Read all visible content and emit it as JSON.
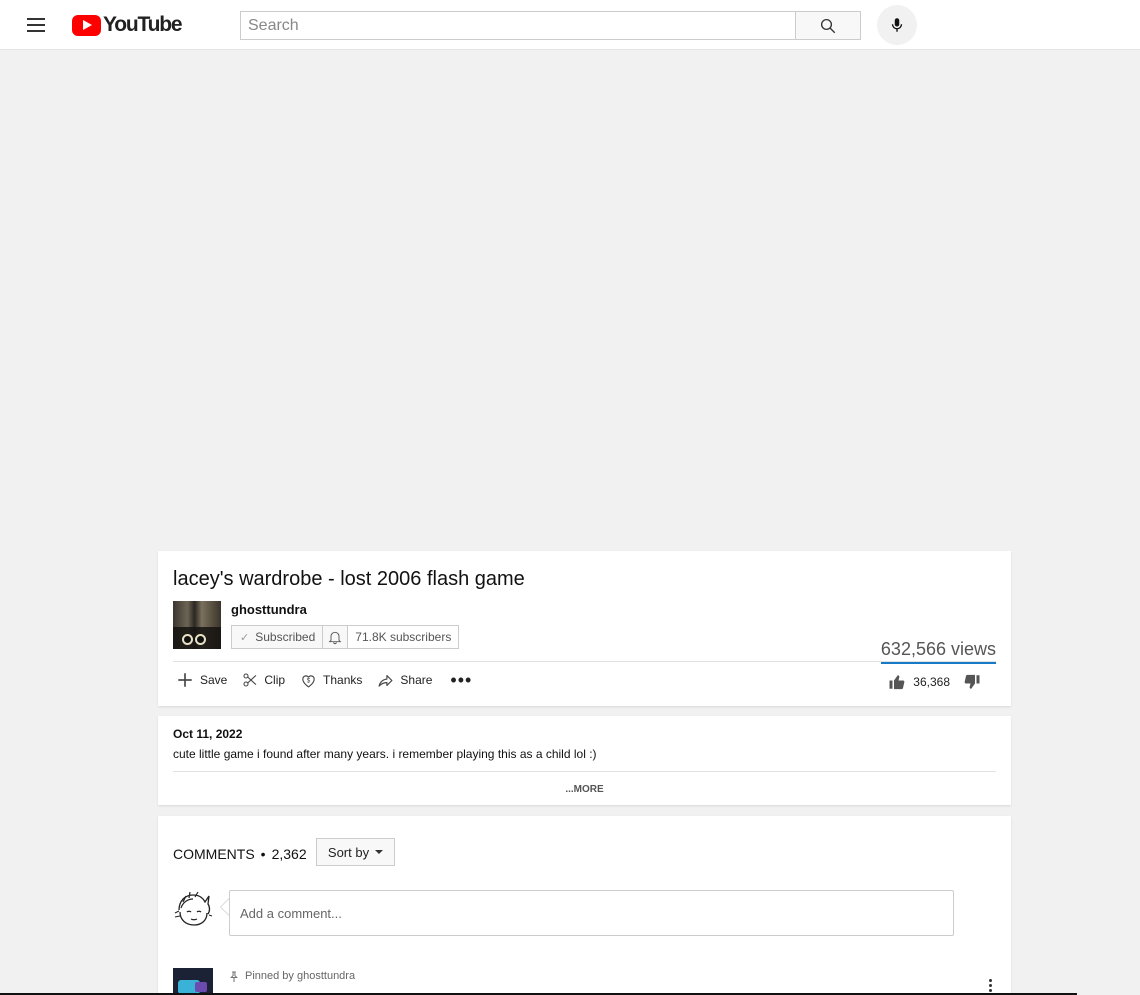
{
  "header": {
    "logo_text": "YouTube",
    "search_placeholder": "Search"
  },
  "video": {
    "title": "lacey's wardrobe - lost 2006 flash game",
    "channel_name": "ghosttundra",
    "subscribe_label": "Subscribed",
    "subscriber_count": "71.8K subscribers",
    "views": "632,566 views",
    "like_count": "36,368",
    "actions": {
      "save": "Save",
      "clip": "Clip",
      "thanks": "Thanks",
      "share": "Share",
      "more": "•••"
    }
  },
  "description": {
    "date": "Oct 11, 2022",
    "text": "cute little game i found after many years. i remember playing this as a child lol :)",
    "more_label": "...MORE"
  },
  "comments": {
    "header_label": "COMMENTS",
    "separator": "•",
    "count": "2,362",
    "sort_label": "Sort by",
    "input_placeholder": "Add a comment...",
    "pinned_label": "Pinned by ghosttundra"
  },
  "colors": {
    "brand_red": "#ff0000",
    "views_underline": "#167ac6",
    "page_background": "#f1f1f1"
  }
}
